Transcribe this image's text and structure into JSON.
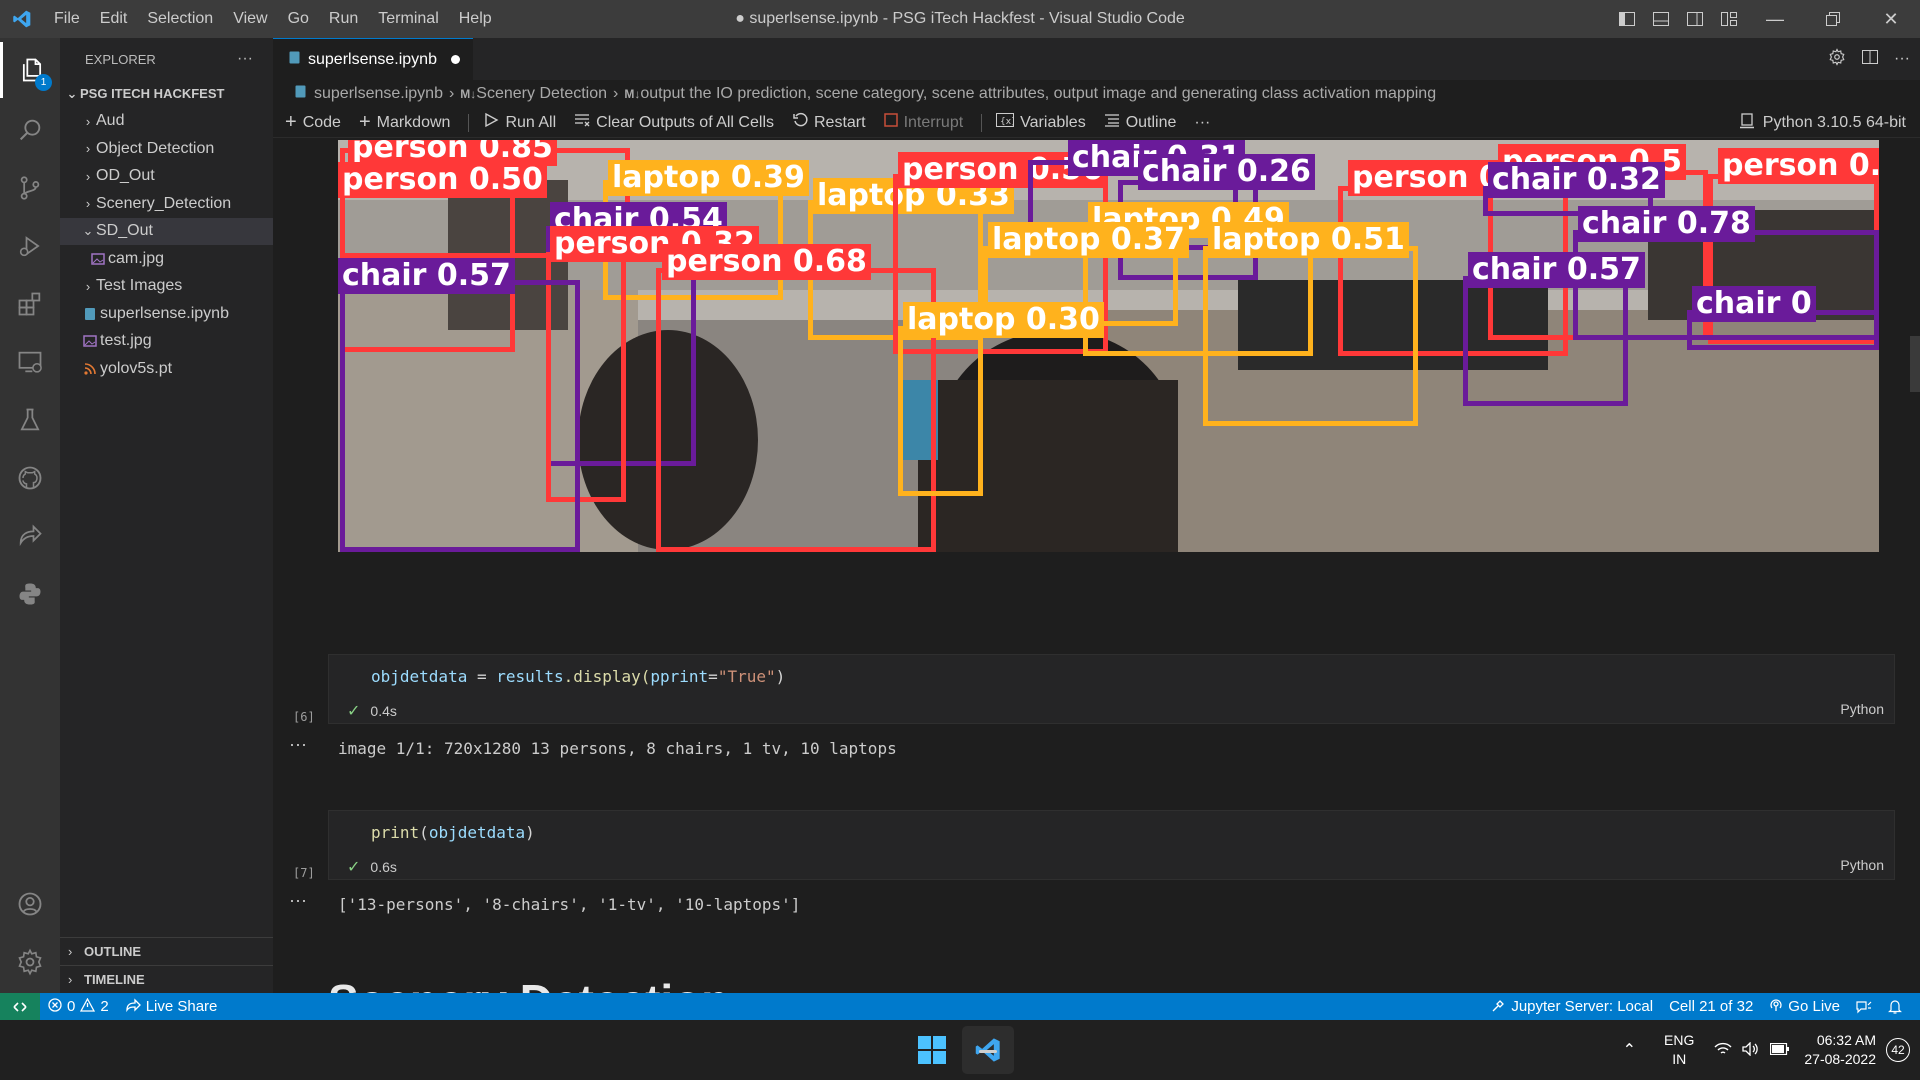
{
  "titlebar": {
    "menu": [
      "File",
      "Edit",
      "Selection",
      "View",
      "Go",
      "Run",
      "Terminal",
      "Help"
    ],
    "title": "● superlsense.ipynb - PSG iTech Hackfest - Visual Studio Code"
  },
  "activitybar": {
    "items": [
      "explorer-icon",
      "search-icon",
      "source-control-icon",
      "run-debug-icon",
      "extensions-icon",
      "remote-explorer-icon",
      "testing-icon",
      "github-icon",
      "live-share-icon",
      "python-icon",
      "accounts-icon",
      "manage-gear-icon"
    ],
    "explorer_badge": "1"
  },
  "sidebar": {
    "header": "EXPLORER",
    "more": "···",
    "root": "PSG ITECH HACKFEST",
    "items": [
      {
        "label": "Aud",
        "kind": "folder"
      },
      {
        "label": "Object Detection",
        "kind": "folder"
      },
      {
        "label": "OD_Out",
        "kind": "folder"
      },
      {
        "label": "Scenery_Detection",
        "kind": "folder"
      },
      {
        "label": "SD_Out",
        "kind": "folder-open"
      },
      {
        "label": "cam.jpg",
        "kind": "image"
      },
      {
        "label": "Test Images",
        "kind": "folder"
      },
      {
        "label": "superlsense.ipynb",
        "kind": "notebook"
      },
      {
        "label": "test.jpg",
        "kind": "image"
      },
      {
        "label": "yolov5s.pt",
        "kind": "rss"
      }
    ],
    "outline": "OUTLINE",
    "timeline": "TIMELINE"
  },
  "editor": {
    "tab_label": "superlsense.ipynb",
    "breadcrumb": {
      "file": "superlsense.ipynb",
      "section": "Scenery Detection",
      "cell": "output the IO prediction, scene category, scene attributes, output image and generating class activation mapping",
      "md_prefix": "M↓"
    },
    "toolbar": {
      "code": "Code",
      "markdown": "Markdown",
      "run_all": "Run All",
      "clear_outputs": "Clear Outputs of All Cells",
      "restart": "Restart",
      "interrupt": "Interrupt",
      "variables": "Variables",
      "outline": "Outline",
      "more": "···",
      "kernel": "Python 3.10.5 64-bit"
    }
  },
  "notebook": {
    "detections": [
      {
        "label": "person 0.85",
        "color": "#ff3838"
      },
      {
        "label": "person 0.50",
        "color": "#ff3838"
      },
      {
        "label": "laptop 0.39",
        "color": "#ffb21d"
      },
      {
        "label": "laptop 0.33",
        "color": "#ffb21d"
      },
      {
        "label": "person 0.56",
        "color": "#ff3838"
      },
      {
        "label": "chair 0.31",
        "color": "#6a1b9a"
      },
      {
        "label": "chair 0.26",
        "color": "#6a1b9a"
      },
      {
        "label": "person 0.70",
        "color": "#ff3838"
      },
      {
        "label": "person 0.5",
        "color": "#ff3838"
      },
      {
        "label": "person 0.",
        "color": "#ff3838"
      },
      {
        "label": "chair 0.54",
        "color": "#6a1b9a"
      },
      {
        "label": "person 0.32",
        "color": "#ff3838"
      },
      {
        "label": "laptop 0.49",
        "color": "#ffb21d"
      },
      {
        "label": "laptop 0.37",
        "color": "#ffb21d"
      },
      {
        "label": "laptop 0.51",
        "color": "#ffb21d"
      },
      {
        "label": "chair 0.32",
        "color": "#6a1b9a"
      },
      {
        "label": "chair 0.78",
        "color": "#6a1b9a"
      },
      {
        "label": "chair 0.57",
        "color": "#6a1b9a"
      },
      {
        "label": "person 0.68",
        "color": "#ff3838"
      },
      {
        "label": "chair 0.57",
        "color": "#6a1b9a"
      },
      {
        "label": "chair 0",
        "color": "#6a1b9a"
      },
      {
        "label": "laptop 0.30",
        "color": "#ffb21d"
      }
    ],
    "cells": [
      {
        "exec": "[6]",
        "code_var": "objdetdata",
        "code_op": " = ",
        "code_obj": "results",
        "code_fn": ".display(",
        "code_param": "pprint",
        "code_eq": "=",
        "code_str": "\"True\"",
        "code_close": ")",
        "time": "0.4s",
        "lang": "Python",
        "output": "image 1/1: 720x1280 13 persons, 8 chairs, 1 tv, 10 laptops"
      },
      {
        "exec": "[7]",
        "code_fn": "print",
        "code_open": "(",
        "code_arg": "objdetdata",
        "code_close": ")",
        "time": "0.6s",
        "lang": "Python",
        "output": "['13-persons', '8-chairs', '1-tv', '10-laptops']"
      }
    ],
    "out_dots": "···",
    "heading": "Scenery Detection"
  },
  "statusbar": {
    "errors": "0",
    "warnings": "2",
    "live_share": "Live Share",
    "jupyter": "Jupyter Server: Local",
    "cell": "Cell 21 of 32",
    "go_live": "Go Live"
  },
  "taskbar": {
    "lang_top": "ENG",
    "lang_bottom": "IN",
    "time": "06:32 AM",
    "date": "27-08-2022",
    "notifications": "42"
  },
  "colors": {
    "accent": "#007acc",
    "statusbar": "#007acc",
    "person_box": "#ff3838",
    "laptop_box": "#ffb21d",
    "chair_box": "#6a1b9a"
  }
}
